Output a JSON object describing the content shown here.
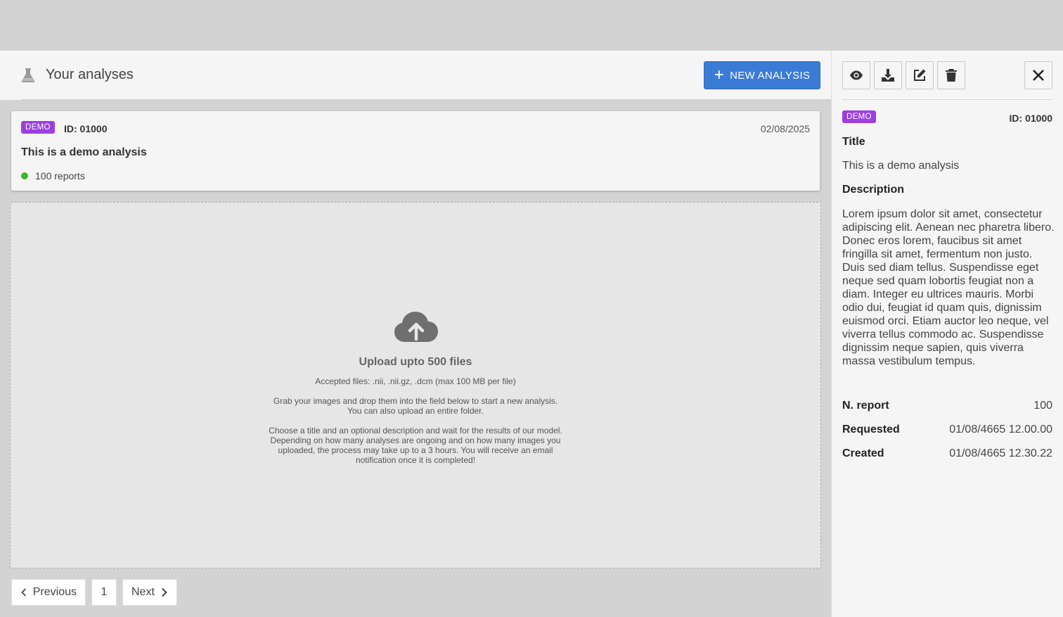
{
  "header": {
    "title": "Your analyses",
    "new_button_label": "NEW ANALYSIS"
  },
  "analyses": [
    {
      "badge": "DEMO",
      "id": "ID: 01000",
      "date": "02/08/2025",
      "title": "This is a demo analysis",
      "reports": "100 reports",
      "status_color": "#3cb62f"
    }
  ],
  "upload": {
    "title": "Upload upto 500 files",
    "accepted": "Accepted files: .nii, .nii.gz, .dcm (max 100 MB per file)",
    "grab_line1": "Grab your images and drop them into the field below to start a new analysis.",
    "grab_line2": "You can also upload an entire folder.",
    "choose_line1": "Choose a title and an optional description and wait for the results of our model.",
    "choose_line2": "Depending on how many analyses are ongoing and on how many images you",
    "choose_line3": "uploaded, the process may take up to a 3 hours. You will receive an email",
    "choose_line4": "notification once it is completed!"
  },
  "pagination": {
    "previous_label": "Previous",
    "current_page": "1",
    "next_label": "Next"
  },
  "details": {
    "badge": "DEMO",
    "id": "ID: 01000",
    "title_label": "Title",
    "title_value": "This is a demo analysis",
    "description_label": "Description",
    "description_value": "Lorem ipsum dolor sit amet, consectetur adipiscing elit. Aenean nec pharetra libero. Donec eros lorem, faucibus sit amet fringilla sit amet, fermentum non justo. Duis sed diam tellus. Suspendisse eget neque sed quam lobortis feugiat non a diam. Integer eu ultrices mauris. Morbi odio dui, feugiat id quam quis, dignissim euismod orci. Etiam auctor leo neque, vel viverra tellus commodo ac. Suspendisse dignissim neque sapien, quis viverra massa vestibulum tempus.",
    "report_label": "N. report",
    "report_value": "100",
    "requested_label": "Requested",
    "requested_value": "01/08/4665 12.00.00",
    "created_label": "Created",
    "created_value": "01/08/4665 12.30.22"
  },
  "toolbar_icons": [
    "eye-icon",
    "download-icon",
    "edit-icon",
    "trash-icon",
    "close-icon"
  ],
  "colors": {
    "accent": "#3a7bd5",
    "badge": "#9b3fe0",
    "status_ok": "#3cb62f"
  }
}
